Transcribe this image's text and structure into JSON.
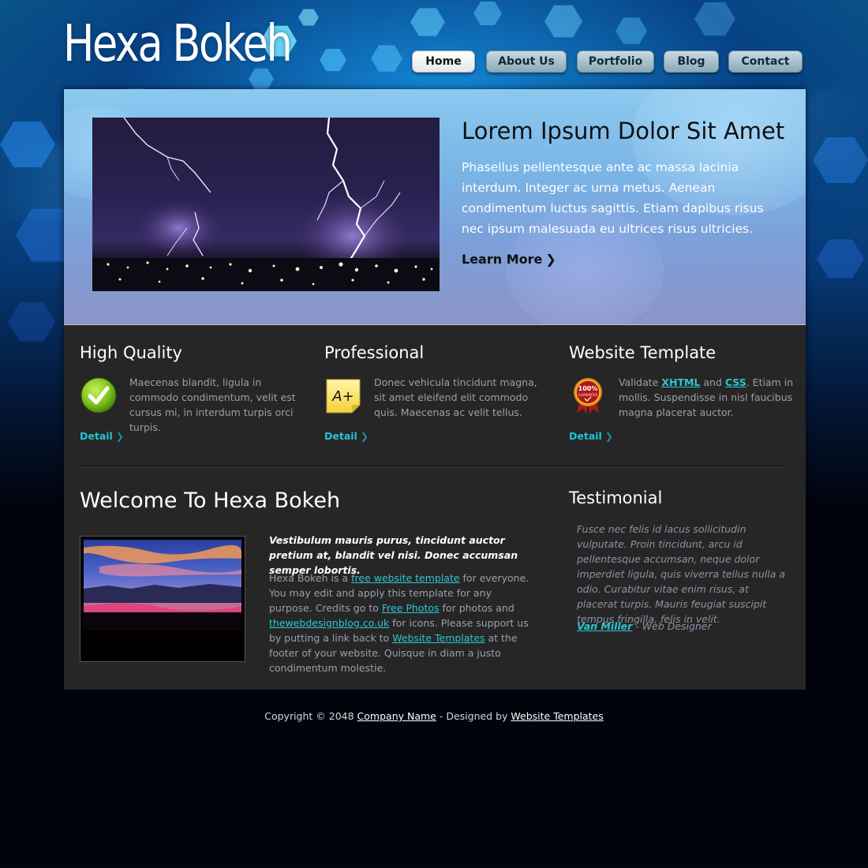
{
  "site": {
    "logo": "Hexa Bokeh"
  },
  "nav": {
    "items": [
      {
        "label": "Home",
        "active": true
      },
      {
        "label": "About Us",
        "active": false
      },
      {
        "label": "Portfolio",
        "active": false
      },
      {
        "label": "Blog",
        "active": false
      },
      {
        "label": "Contact",
        "active": false
      }
    ]
  },
  "hero": {
    "title": "Lorem Ipsum Dolor Sit Amet",
    "text": "Phasellus pellentesque ante ac massa lacinia interdum. Integer ac urna metus. Aenean condimentum luctus sagittis. Etiam dapibus risus nec ipsum malesuada eu ultrices risus ultricies.",
    "cta": "Learn More"
  },
  "features": [
    {
      "title": "High Quality",
      "text": "Maecenas blandit, ligula in commodo condimentum, velit est cursus mi, in interdum turpis orci turpis.",
      "link": "Detail",
      "icon": "check-icon"
    },
    {
      "title": "Professional",
      "text": "Donec vehicula tincidunt magna, sit amet eleifend elit commodo quis. Maecenas ac velit tellus.",
      "link": "Detail",
      "icon": "grade-a-plus-icon",
      "badge": "A+"
    },
    {
      "title": "Website Template",
      "text_prefix": "Validate ",
      "xhtml": "XHTML",
      "and": " and ",
      "css": "CSS",
      "text_suffix": ". Etiam in mollis. Suspendisse in nisl faucibus magna placerat auctor.",
      "link": "Detail",
      "icon": "guarantee-seal-icon",
      "seal_top": "100%",
      "seal_bottom": "GUARANTEE"
    }
  ],
  "welcome": {
    "title": "Welcome To Hexa Bokeh",
    "intro": "Vestibulum mauris purus, tincidunt auctor pretium at, blandit vel nisi. Donec accumsan semper lobortis.",
    "p1": "Hexa Bokeh is a ",
    "l1": "free website template",
    "p2": " for everyone. You may edit and apply this template for any purpose. Credits go to ",
    "l2": "Free Photos",
    "p3": " for photos and ",
    "l3": "thewebdesignblog.co.uk",
    "p4": " for icons. Please support us by putting a link back to ",
    "l4": "Website Templates",
    "p5": " at the footer of your website. Quisque in diam a justo condimentum molestie."
  },
  "testimonial": {
    "title": "Testimonial",
    "quote": "Fusce nec felis id lacus sollicitudin vulputate. Proin tincidunt, arcu id pellentesque accumsan, neque dolor imperdiet ligula, quis viverra tellus nulla a odio. Curabitur vitae enim risus, at placerat turpis. Mauris feugiat suscipit tempus fringilla, felis in velit.",
    "author": "Van Miller",
    "role": " - Web Designer"
  },
  "footer": {
    "prefix": "Copyright © 2048 ",
    "company": "Company Name",
    "middle": " - Designed by ",
    "designer": "Website Templates"
  },
  "colors": {
    "accent": "#2ec6d4",
    "panel": "#262626",
    "page_bg_bottom": "#02040d"
  }
}
